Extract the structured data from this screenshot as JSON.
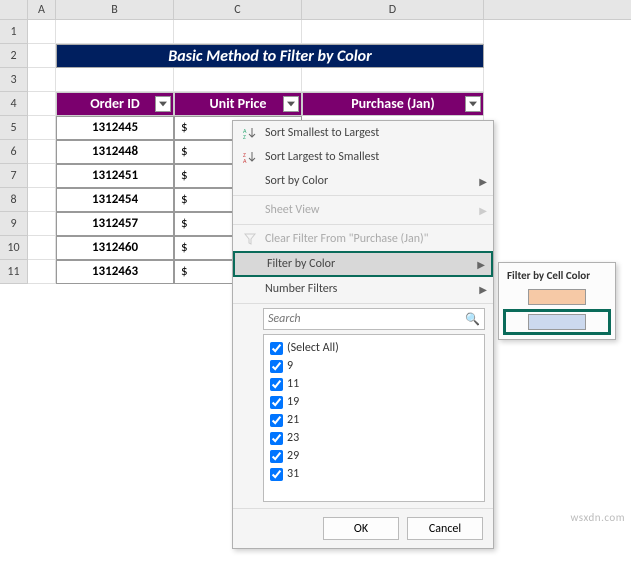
{
  "columns": [
    "A",
    "B",
    "C",
    "D"
  ],
  "rows": [
    "1",
    "2",
    "3",
    "4",
    "5",
    "6",
    "7",
    "8",
    "9",
    "10",
    "11"
  ],
  "title": "Basic Method to Filter by Color",
  "headers": {
    "b": "Order ID",
    "c": "Unit Price",
    "d": "Purchase (Jan)"
  },
  "data_rows": [
    {
      "order": "1312445",
      "price": "$"
    },
    {
      "order": "1312448",
      "price": "$"
    },
    {
      "order": "1312451",
      "price": "$"
    },
    {
      "order": "1312454",
      "price": "$"
    },
    {
      "order": "1312457",
      "price": "$"
    },
    {
      "order": "1312460",
      "price": "$"
    },
    {
      "order": "1312463",
      "price": "$"
    }
  ],
  "menu": {
    "sort_asc": "Sort Smallest to Largest",
    "sort_desc": "Sort Largest to Smallest",
    "sort_color": "Sort by Color",
    "sheet_view": "Sheet View",
    "clear": "Clear Filter From \"Purchase (Jan)\"",
    "filter_color": "Filter by Color",
    "number_filters": "Number Filters",
    "search_placeholder": "Search",
    "select_all": "(Select All)",
    "items": [
      "9",
      "11",
      "19",
      "21",
      "23",
      "29",
      "31"
    ],
    "ok": "OK",
    "cancel": "Cancel"
  },
  "submenu": {
    "title": "Filter by Cell Color",
    "colors": {
      "orange": "#f6c9a6",
      "blue": "#ccd9ee"
    }
  },
  "watermark": "wsxdn.com"
}
